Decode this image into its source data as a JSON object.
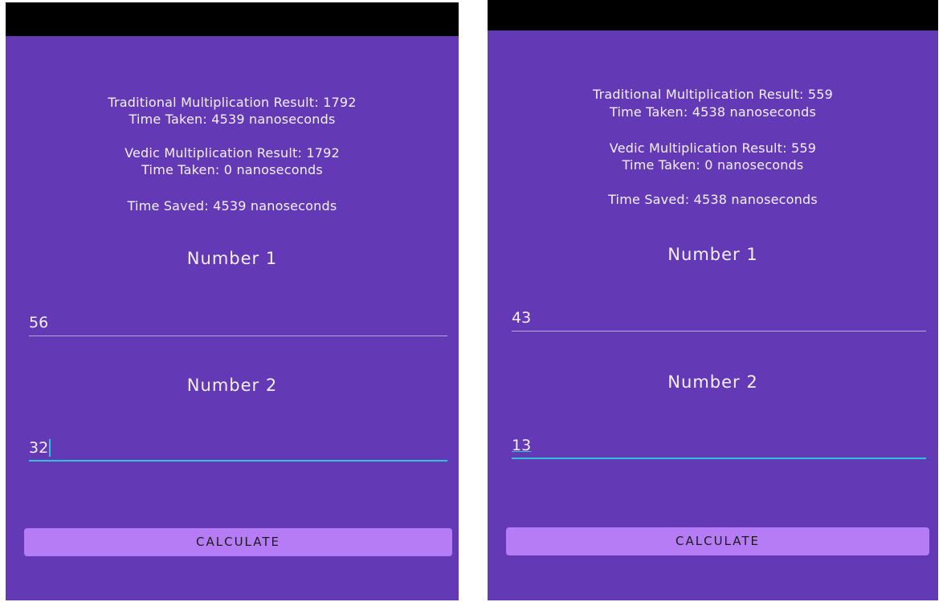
{
  "screens": [
    {
      "traditional_result": "Traditional Multiplication Result: 1792",
      "traditional_time": "Time Taken: 4539 nanoseconds",
      "vedic_result": "Vedic Multiplication Result: 1792",
      "vedic_time": "Time Taken: 0 nanoseconds",
      "time_saved": "Time Saved: 4539 nanoseconds",
      "number1_label": "Number 1",
      "number1_value": "56",
      "number2_label": "Number 2",
      "number2_value": "32",
      "calculate_label": "CALCULATE"
    },
    {
      "traditional_result": "Traditional Multiplication Result: 559",
      "traditional_time": "Time Taken: 4538 nanoseconds",
      "vedic_result": "Vedic Multiplication Result: 559",
      "vedic_time": "Time Taken: 0 nanoseconds",
      "time_saved": "Time Saved: 4538 nanoseconds",
      "number1_label": "Number 1",
      "number1_value": "43",
      "number2_label": "Number 2",
      "number2_value": "13",
      "calculate_label": "CALCULATE"
    }
  ],
  "colors": {
    "background": "#6439b6",
    "status_bar": "#000000",
    "text": "#f3f0fa",
    "button": "#b57cf6",
    "button_text": "#1b1b1b",
    "focus_accent": "#2fc2d8",
    "underline": "#b9a7e0"
  }
}
